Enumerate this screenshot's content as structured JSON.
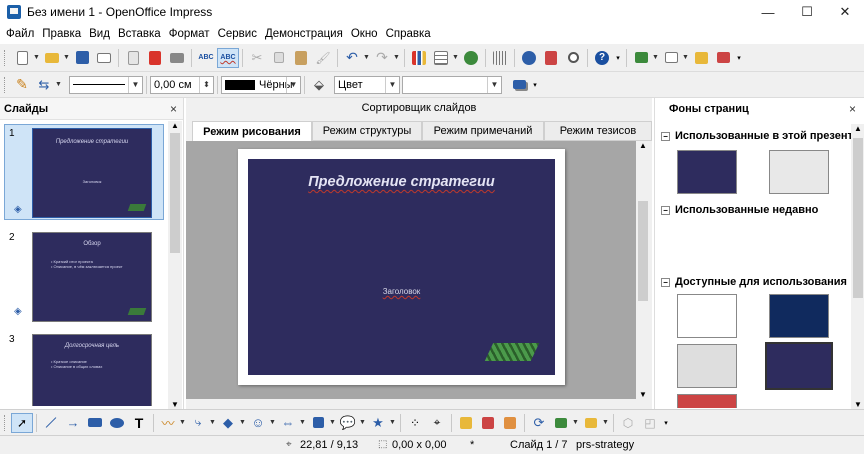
{
  "window": {
    "title": "Без имени 1 - OpenOffice Impress",
    "minimize": "—",
    "maximize": "☐",
    "close": "✕"
  },
  "menu": [
    "Файл",
    "Правка",
    "Вид",
    "Вставка",
    "Формат",
    "Сервис",
    "Демонстрация",
    "Окно",
    "Справка"
  ],
  "format_bar": {
    "line_width": "0,00 см",
    "line_color": "Чёрны",
    "area_style": "Цвет",
    "area_color": ""
  },
  "slides_panel": {
    "title": "Слайды",
    "close": "×",
    "slides": [
      {
        "number": "1",
        "title": "Предложение стратегии",
        "body": "Заголовок"
      },
      {
        "number": "2",
        "title": "Обзор",
        "body": "• Краткий итог проекта\n• Описание, в чём заключается проект"
      },
      {
        "number": "3",
        "title": "Долгосрочная цель",
        "body": "• Краткое описание\n• Описание в общих словах"
      }
    ]
  },
  "editor": {
    "sorter_label": "Сортировщик слайдов",
    "tabs": [
      "Режим рисования",
      "Режим структуры",
      "Режим примечаний",
      "Режим тезисов"
    ],
    "active_tab": "Режим рисования",
    "slide_title": "Предложение стратегии",
    "slide_subtitle": "Заголовок"
  },
  "bg_panel": {
    "title": "Фоны страниц",
    "close": "×",
    "sections": [
      {
        "label": "Использованные в этой презентации",
        "toggle": "−"
      },
      {
        "label": "Использованные недавно",
        "toggle": "−"
      },
      {
        "label": "Доступные для использования",
        "toggle": "−"
      }
    ]
  },
  "status": {
    "position": "22,81 / 9,13",
    "size": "0,00 x 0,00",
    "modified": "*",
    "slide": "Слайд 1 / 7",
    "master": "prs-strategy"
  },
  "colors": {
    "slide_bg": "#2e2c5e",
    "toolbar_bg": "#f0f0f0",
    "selection": "#cfe4f7"
  }
}
